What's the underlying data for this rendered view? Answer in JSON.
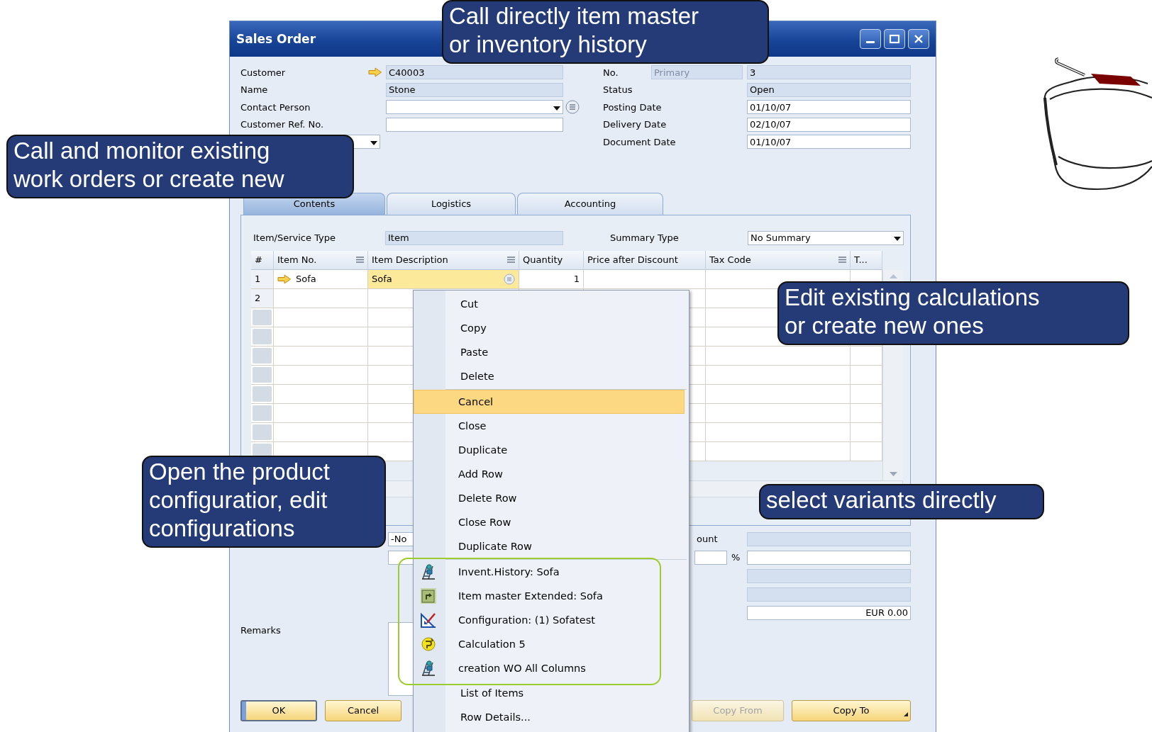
{
  "window": {
    "title": "Sales Order"
  },
  "header_left": [
    {
      "kind": "link",
      "label": "Customer",
      "value": "C40003"
    },
    {
      "kind": "readonly",
      "label": "Name",
      "value": "Stone"
    },
    {
      "kind": "dropdown",
      "label": "Contact Person"
    },
    {
      "kind": "input",
      "label": "Customer Ref. No."
    },
    {
      "kind": "dropdown-short"
    }
  ],
  "header_right": [
    {
      "kind": "numbered",
      "label": "No.",
      "series": "Primary",
      "value": "3"
    },
    {
      "kind": "readonly",
      "label": "Status",
      "value": "Open"
    },
    {
      "kind": "input",
      "label": "Posting Date",
      "value": "01/10/07"
    },
    {
      "kind": "input",
      "label": "Delivery Date",
      "value": "02/10/07"
    },
    {
      "kind": "input",
      "label": "Document Date",
      "value": "01/10/07"
    }
  ],
  "tabs": [
    {
      "label": "Contents",
      "selected": true
    },
    {
      "label": "Logistics",
      "selected": false
    },
    {
      "label": "Accounting",
      "selected": false
    }
  ],
  "item_type": {
    "label": "Item/Service Type",
    "value": "Item"
  },
  "summary_type": {
    "label": "Summary Type",
    "value": "No Summary"
  },
  "table": {
    "columns": [
      {
        "label": "#",
        "menu": false
      },
      {
        "label": "Item No.",
        "menu": true
      },
      {
        "label": "Item Description",
        "menu": true
      },
      {
        "label": "Quantity",
        "menu": false
      },
      {
        "label": "Price after Discount",
        "menu": false
      },
      {
        "label": "Tax Code",
        "menu": true
      },
      {
        "label": "T...",
        "menu": false
      }
    ],
    "rows": [
      {
        "number": "1",
        "item_no": "Sofa",
        "description": "Sofa",
        "quantity": "1",
        "selected": true
      },
      {
        "number": "2",
        "selected": false
      }
    ]
  },
  "footer": {
    "sales_employee": "-No",
    "label_fragment": "ount",
    "percent": "%",
    "total": "EUR 0.00",
    "remarks_label": "Remarks"
  },
  "buttons_left": [
    {
      "label": "OK",
      "kind": "primary",
      "disabled": false
    },
    {
      "label": "Cancel",
      "kind": "plain",
      "disabled": false
    }
  ],
  "buttons_right": [
    {
      "label": "Copy From",
      "kind": "plain",
      "disabled": true
    },
    {
      "label": "Copy To",
      "kind": "menu",
      "disabled": false
    }
  ],
  "context_menu": {
    "groups": [
      {
        "divided": false,
        "framed": false,
        "items": [
          {
            "kind": "text",
            "label": "Cut",
            "selected": false
          },
          {
            "kind": "text",
            "label": "Copy",
            "selected": false
          },
          {
            "kind": "text",
            "label": "Paste",
            "selected": false
          },
          {
            "kind": "text",
            "label": "Delete",
            "selected": false
          }
        ]
      },
      {
        "divided": true,
        "framed": false,
        "items": [
          {
            "kind": "text",
            "label": "Cancel",
            "selected": true
          },
          {
            "kind": "text",
            "label": "Close",
            "selected": false
          },
          {
            "kind": "text",
            "label": "Duplicate",
            "selected": false
          },
          {
            "kind": "text",
            "label": "Add Row",
            "selected": false
          },
          {
            "kind": "text",
            "label": "Delete Row",
            "selected": false
          },
          {
            "kind": "text",
            "label": "Close Row",
            "selected": false
          },
          {
            "kind": "text",
            "label": "Duplicate Row",
            "selected": false
          }
        ]
      },
      {
        "divided": true,
        "framed": true,
        "items": [
          {
            "kind": "history",
            "label": "Invent.History: Sofa",
            "selected": false
          },
          {
            "kind": "master",
            "label": "Item master Extended: Sofa",
            "selected": false
          },
          {
            "kind": "config",
            "label": "Configuration: (1) Sofatest",
            "selected": false
          },
          {
            "kind": "calc",
            "label": "Calculation 5",
            "selected": false
          },
          {
            "kind": "history",
            "label": "creation WO All Columns",
            "selected": false
          }
        ]
      },
      {
        "divided": false,
        "framed": false,
        "items": [
          {
            "kind": "text",
            "label": "List of Items",
            "selected": false
          },
          {
            "kind": "text",
            "label": "Row Details...",
            "selected": false
          }
        ]
      }
    ]
  },
  "callouts": [
    {
      "text": "Call directly item master\nor inventory history"
    },
    {
      "text": "Call and monitor existing\nwork orders or create new"
    },
    {
      "text": "Edit existing calculations\nor create new ones"
    },
    {
      "text": "Open the product\nconfiguratior, edit\nconfigurations"
    },
    {
      "text": "select variants directly"
    }
  ]
}
